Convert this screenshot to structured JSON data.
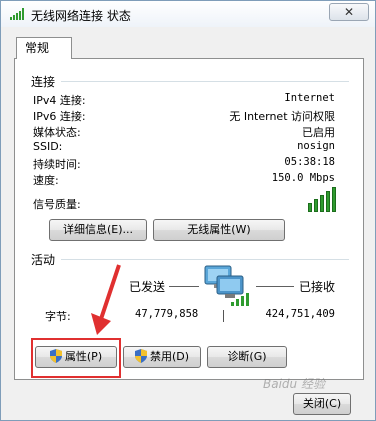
{
  "window": {
    "title": "无线网络连接 状态",
    "close_label": "✕"
  },
  "tab": {
    "label": "常规"
  },
  "connection": {
    "section_label": "连接",
    "rows": [
      {
        "label": "IPv4 连接:",
        "value": "Internet"
      },
      {
        "label": "IPv6 连接:",
        "value": "无 Internet 访问权限"
      },
      {
        "label": "媒体状态:",
        "value": "已启用"
      },
      {
        "label": "SSID:",
        "value": "nosign"
      },
      {
        "label": "持续时间:",
        "value": "05:38:18"
      },
      {
        "label": "速度:",
        "value": "150.0 Mbps"
      }
    ],
    "signal_label": "信号质量:",
    "signal_bars": 5,
    "details_button": "详细信息(E)...",
    "wireless_props_button": "无线属性(W)"
  },
  "activity": {
    "section_label": "活动",
    "sent_label": "已发送",
    "received_label": "已接收",
    "bytes_label": "字节:",
    "sent_value": "47,779,858",
    "received_value": "424,751,409",
    "properties_button": "属性(P)",
    "disable_button": "禁用(D)",
    "diagnose_button": "诊断(G)"
  },
  "footer": {
    "close_button": "关闭(C)"
  },
  "watermark": "Baidu 经验",
  "colors": {
    "highlight_box": "#e03030",
    "signal": "#2f9b2f",
    "arrow": "#e03030"
  }
}
